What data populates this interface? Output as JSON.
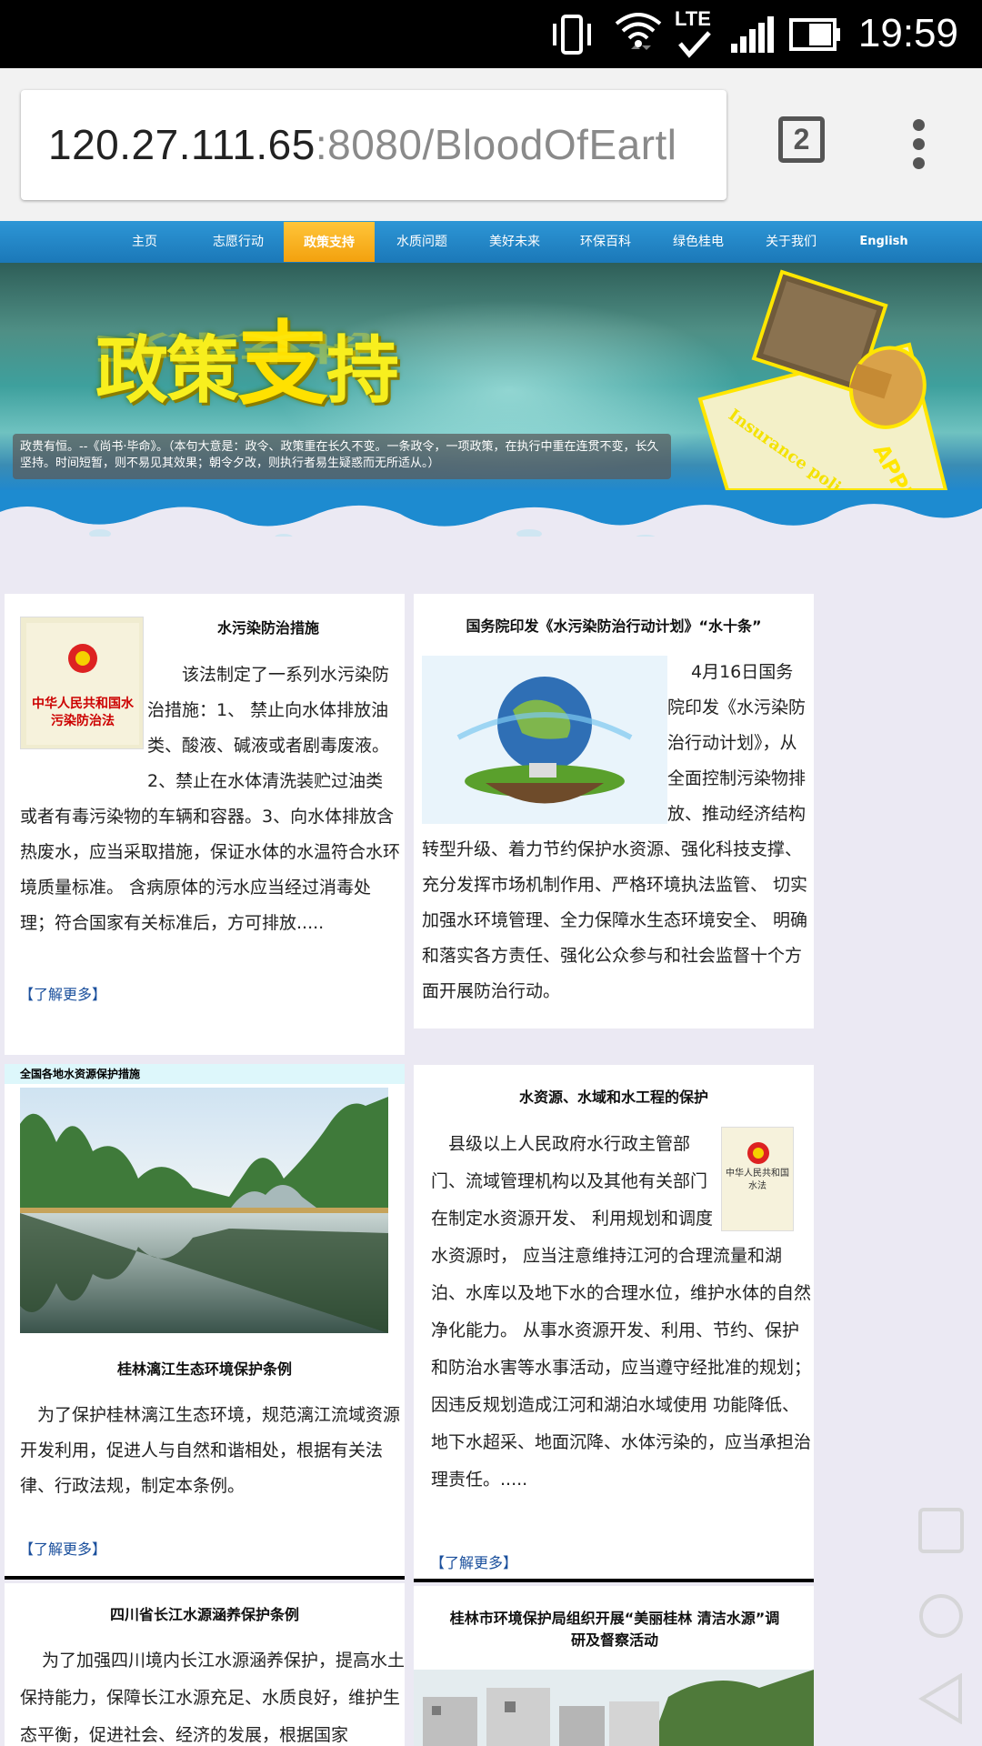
{
  "status_bar": {
    "time": "19:59",
    "network": "LTE"
  },
  "browser": {
    "url_host": "120.27.111.65",
    "url_path": ":8080/BloodOfEartl",
    "tab_count": "2"
  },
  "nav": {
    "items": [
      "主页",
      "志愿行动",
      "政策支持",
      "水质问题",
      "美好未来",
      "环保百科",
      "绿色桂电",
      "关于我们",
      "English"
    ],
    "active_index": 2
  },
  "banner": {
    "title_a": "政策",
    "title_b": "支",
    "title_c": "持",
    "caption": "政贵有恒。--《尚书·毕命》。（本句大意是：政令、政策重在长久不变。一条政令，一项政策，在执行中重在连贯不变，长久坚持。时间短暂，则不易见其效果；朝令夕改，则执行者易生疑惑而无所适从。）",
    "stamp_text": "APPROVED",
    "stamp_paper_text": "Insurance policy."
  },
  "cards": {
    "c1": {
      "title": "水污染防治措施",
      "book_title": "中华人民共和国水污染防治法",
      "text": "该法制定了一系列水污染防治措施：1、 禁止向水体排放油类、酸液、碱液或者剧毒废液。2、禁止在水体清洗装贮过油类或者有毒污染物的车辆和容器。3、向水体排放含热废水，应当采取措施，保证水体的水温符合水环境质量标准。 含病原体的污水应当经过消毒处理；符合国家有关标准后，方可排放.....",
      "more": "【了解更多】"
    },
    "c2": {
      "title": "国务院印发《水污染防治行动计划》“水十条”",
      "text": "4月16日国务院印发《水污染防治行动计划》，从全面控制污染物排放、推动经济结构转型升级、着力节约保护水资源、强化科技支撑、充分发挥市场机制作用、严格环境执法监管、 切实加强水环境管理、全力保障水生态环境安全、 明确和落实各方责任、强化公众参与和社会监督十个方面开展防治行动。"
    },
    "c3": {
      "header": "全国各地水资源保护措施",
      "title": "桂林漓江生态环境保护条例",
      "text": "为了保护桂林漓江生态环境，规范漓江流域资源开发利用，促进人与自然和谐相处，根据有关法律、行政法规，制定本条例。",
      "more": "【了解更多】"
    },
    "c4": {
      "title": "水资源、水域和水工程的保护",
      "book_title": "中华人民共和国水法",
      "text": "县级以上人民政府水行政主管部门、流域管理机构以及其他有关部门在制定水资源开发、 利用规划和调度水资源时， 应当注意维持江河的合理流量和湖泊、水库以及地下水的合理水位，维护水体的自然净化能力。 从事水资源开发、利用、节约、保护和防治水害等水事活动，应当遵守经批准的规划；因违反规划造成江河和湖泊水域使用 功能降低、地下水超采、地面沉降、水体污染的，应当承担治理责任。.....",
      "more": "【了解更多】"
    },
    "c5": {
      "title": "四川省长江水源涵养保护条例",
      "text": "为了加强四川境内长江水源涵养保护，提高水土保持能力，保障长江水源充足、水质良好，维护生态平衡，促进社会、经济的发展，根据国家"
    },
    "c6": {
      "title": "桂林市环境保护局组织开展“美丽桂林 清洁水源”调研及督察活动"
    }
  }
}
